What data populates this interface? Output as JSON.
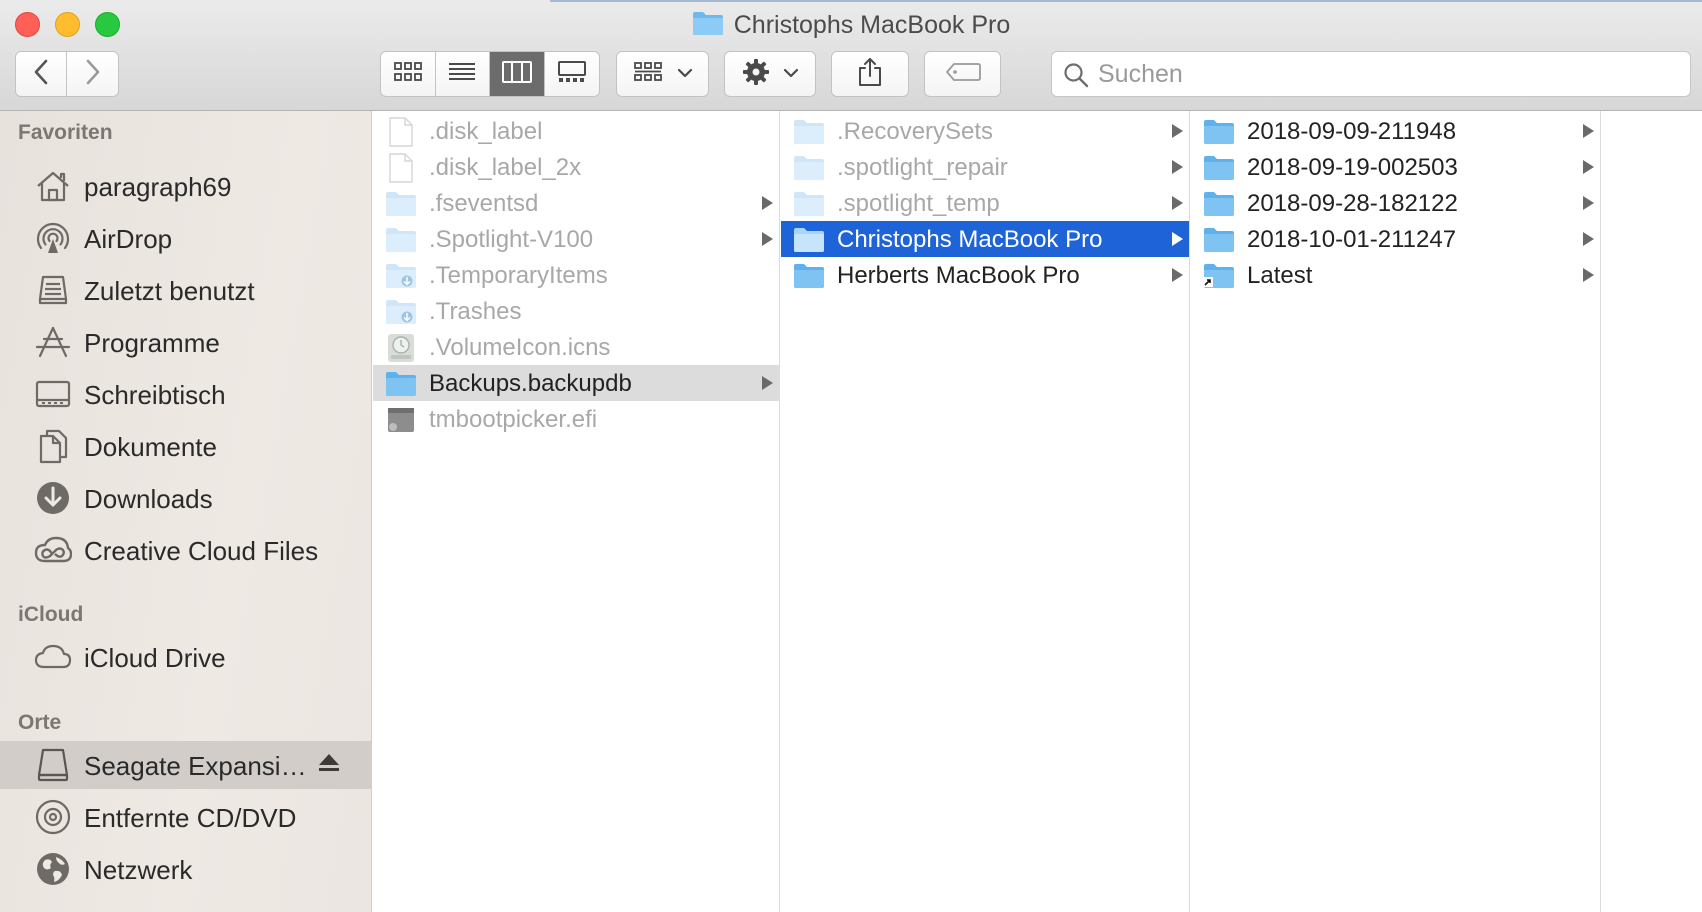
{
  "window": {
    "title": "Christophs MacBook Pro"
  },
  "toolbar": {
    "back_icon": "chevron-left-icon",
    "forward_icon": "chevron-right-icon",
    "view_modes": [
      "icon-view",
      "list-view",
      "column-view",
      "gallery-view"
    ],
    "active_view": "column-view",
    "search_placeholder": "Suchen"
  },
  "sidebar": {
    "sections": [
      {
        "title": "Favoriten",
        "items": [
          {
            "label": "paragraph69",
            "icon": "home-icon"
          },
          {
            "label": "AirDrop",
            "icon": "airdrop-icon"
          },
          {
            "label": "Zuletzt benutzt",
            "icon": "recents-icon"
          },
          {
            "label": "Programme",
            "icon": "applications-icon"
          },
          {
            "label": "Schreibtisch",
            "icon": "desktop-icon"
          },
          {
            "label": "Dokumente",
            "icon": "document-icon"
          },
          {
            "label": "Downloads",
            "icon": "downloads-icon"
          },
          {
            "label": "Creative Cloud Files",
            "icon": "creative-cloud-icon"
          }
        ]
      },
      {
        "title": "iCloud",
        "items": [
          {
            "label": "iCloud Drive",
            "icon": "cloud-icon"
          }
        ]
      },
      {
        "title": "Orte",
        "items": [
          {
            "label": "Seagate Expansi…",
            "icon": "drive-icon",
            "selected": true,
            "eject": true
          },
          {
            "label": "Entfernte CD/DVD",
            "icon": "disc-icon"
          },
          {
            "label": "Netzwerk",
            "icon": "globe-icon"
          }
        ]
      }
    ]
  },
  "columns": [
    {
      "items": [
        {
          "label": ".disk_label",
          "icon": "file-icon",
          "dim": true
        },
        {
          "label": ".disk_label_2x",
          "icon": "file-icon",
          "dim": true
        },
        {
          "label": ".fseventsd",
          "icon": "folder-icon",
          "dim": true,
          "arrow": true
        },
        {
          "label": ".Spotlight-V100",
          "icon": "folder-icon",
          "dim": true,
          "arrow": true
        },
        {
          "label": ".TemporaryItems",
          "icon": "folder-download-icon",
          "dim": true
        },
        {
          "label": ".Trashes",
          "icon": "folder-download-icon",
          "dim": true
        },
        {
          "label": ".VolumeIcon.icns",
          "icon": "timemachine-icns-icon",
          "dim": true
        },
        {
          "label": "Backups.backupdb",
          "icon": "folder-icon",
          "arrow": true,
          "selected": "gray"
        },
        {
          "label": "tmbootpicker.efi",
          "icon": "efi-file-icon",
          "dim": true
        }
      ]
    },
    {
      "items": [
        {
          "label": ".RecoverySets",
          "icon": "folder-icon",
          "dim": true,
          "arrow": true
        },
        {
          "label": ".spotlight_repair",
          "icon": "folder-icon",
          "dim": true,
          "arrow": true
        },
        {
          "label": ".spotlight_temp",
          "icon": "folder-icon",
          "dim": true,
          "arrow": true
        },
        {
          "label": "Christophs MacBook Pro",
          "icon": "folder-icon",
          "arrow": true,
          "selected": "blue"
        },
        {
          "label": "Herberts MacBook Pro",
          "icon": "folder-icon",
          "arrow": true
        }
      ]
    },
    {
      "items": [
        {
          "label": "2018-09-09-211948",
          "icon": "folder-icon",
          "arrow": true
        },
        {
          "label": "2018-09-19-002503",
          "icon": "folder-icon",
          "arrow": true
        },
        {
          "label": "2018-09-28-182122",
          "icon": "folder-icon",
          "arrow": true
        },
        {
          "label": "2018-10-01-211247",
          "icon": "folder-icon",
          "arrow": true
        },
        {
          "label": "Latest",
          "icon": "folder-alias-icon",
          "arrow": true
        }
      ]
    }
  ]
}
